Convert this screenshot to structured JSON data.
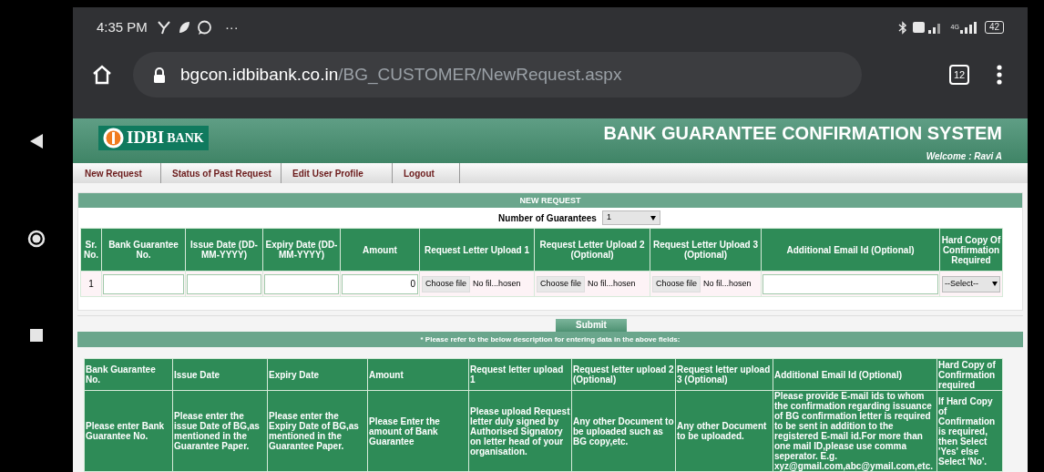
{
  "status_bar": {
    "time": "4:35 PM",
    "more": "···",
    "network_label": "4G",
    "battery": "42"
  },
  "browser": {
    "url_host": "bgcon.idbibank.co.in",
    "url_path": "/BG_CUSTOMER/NewRequest.aspx",
    "tab_count": "12"
  },
  "header": {
    "logo_text": "IDBI",
    "logo_suffix": "BANK",
    "title": "BANK GUARANTEE CONFIRMATION SYSTEM",
    "welcome": "Welcome : Ravi A"
  },
  "nav": [
    {
      "label": "New Request"
    },
    {
      "label": "Status of Past Request"
    },
    {
      "label": "Edit User Profile"
    },
    {
      "label": "Logout"
    }
  ],
  "new_request": {
    "title": "NEW REQUEST",
    "count_label": "Number of Guarantees",
    "count_value": "1",
    "columns": [
      "Sr. No.",
      "Bank Guarantee No.",
      "Issue Date (DD-MM-YYYY)",
      "Expiry Date (DD-MM-YYYY)",
      "Amount",
      "Request Letter Upload 1",
      "Request Letter Upload 2 (Optional)",
      "Request Letter Upload 3 (Optional)",
      "Additional Email Id (Optional)",
      "Hard Copy Of Confirmation Required"
    ],
    "rows": [
      {
        "sr": "1",
        "amount": "0",
        "uploads": [
          {
            "button": "Choose file",
            "status": "No fil...hosen"
          },
          {
            "button": "Choose file",
            "status": "No fil...hosen"
          },
          {
            "button": "Choose file",
            "status": "No fil...hosen"
          }
        ],
        "hard_copy": "--Select--"
      }
    ],
    "submit": "Submit"
  },
  "note": "* Please refer to the below description for entering data in the above fields:",
  "description": {
    "columns": [
      "Bank Guarantee No.",
      "Issue Date",
      "Expiry Date",
      "Amount",
      "Request letter upload 1",
      "Request letter upload 2 (Optional)",
      "Request letter upload 3 (Optional)",
      "Additional Email Id (Optional)",
      "Hard Copy of Confirmation required"
    ],
    "rows": [
      [
        "Please enter Bank Guarantee No.",
        "Please enter the issue Date of BG,as mentioned in the Guarantee Paper.",
        "Please enter the Expiry Date of BG,as mentioned in the Guarantee Paper.",
        "Please Enter the amount of Bank Guarantee",
        "Please upload Request letter duly signed by Authorised Signatory on letter head of your organisation.",
        "Any other Document to be uploaded such as BG copy,etc.",
        "Any other Document to be uploaded.",
        "Please provide E-mail ids to whom the confirmation regarding issuance of BG confirmation letter is required to be sent in addition to the registered E-mail id.For more than  one mail ID,please use comma seperator. E.g. xyz@gmail.com,abc@ymail.com,etc.",
        "If Hard Copy of Confirmation is required, then Select 'Yes' else Select 'No'."
      ]
    ]
  }
}
